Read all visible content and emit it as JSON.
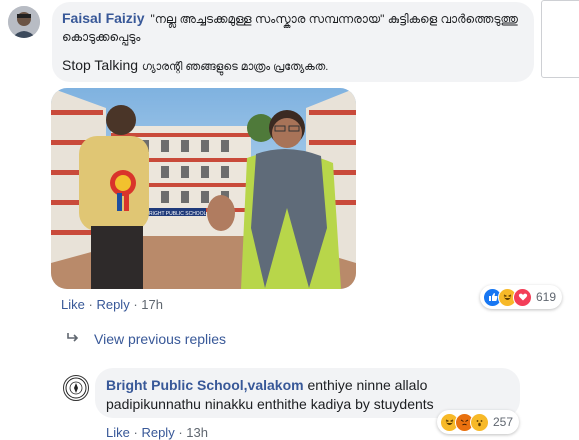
{
  "comment1": {
    "author": "Faisal Faiziy",
    "text_line1": "\"നല്ല അച്ചടക്കമുള്ള സംസ്കാര സമ്പന്നരായ\" കുട്ടികളെ വാർത്തെടുത്തു",
    "text_line2": "കൊടുക്കപ്പെടും",
    "text_line3_bold": "Stop Talking",
    "text_line3_rest": "ഗ്യാരന്റി ഞങ്ങളുടെ മാത്രം പ്രത്യേകത.",
    "actions": {
      "like": "Like",
      "reply": "Reply",
      "time": "17h"
    },
    "reaction_icons": [
      "like-icon",
      "haha-icon",
      "love-icon"
    ],
    "reaction_count": "619"
  },
  "photo": {
    "school_sign": "BRIGHT PUBLIC SCHOOL"
  },
  "view_previous_replies": "View previous replies",
  "reply1": {
    "author": "Bright Public School,valakom",
    "text_line1": "enthiye ninne allalo",
    "text_line2": "padipikunnathu ninakku enthithe kadiya by stuydents",
    "actions": {
      "like": "Like",
      "reply": "Reply",
      "time": "13h"
    },
    "reaction_icons": [
      "haha-icon",
      "angry-icon",
      "wow-icon"
    ],
    "reaction_count": "257"
  },
  "colors": {
    "link_blue": "#385898",
    "bubble_bg": "#f2f3f5",
    "like_blue": "#1877f2",
    "love_red": "#f33e58",
    "haha_yellow": "#f7b928"
  }
}
